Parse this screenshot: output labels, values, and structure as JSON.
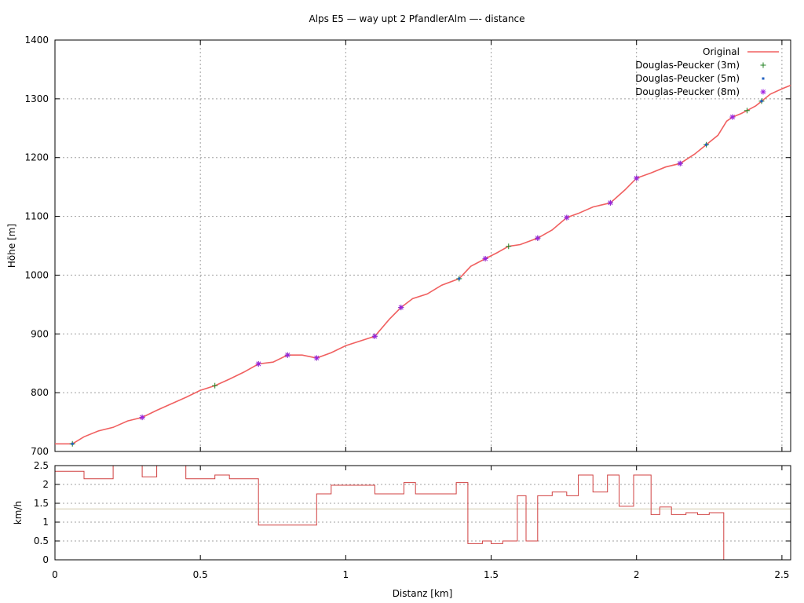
{
  "title": "Alps E5 — way upt 2 PfandlerAlm —- distance",
  "colors": {
    "original": "#f06060",
    "dp3": "#208020",
    "dp5": "#2060c0",
    "dp8": "#a020e0",
    "speed": "#d04040",
    "avg": "#d8d0b8",
    "grid": "#a0a0a0"
  },
  "chart_data": [
    {
      "type": "line",
      "ylabel": "Höhe [m]",
      "xlim": [
        0,
        2.53
      ],
      "ylim": [
        700,
        1400
      ],
      "grid": true,
      "legend_position": "top-right",
      "xticks": [
        "0",
        "0.5",
        "1",
        "1.5",
        "2",
        "2.5"
      ],
      "yticks": [
        "700",
        "800",
        "900",
        "1000",
        "1100",
        "1200",
        "1300",
        "1400"
      ],
      "series": [
        {
          "name": "Original",
          "style": "line",
          "x": [
            0,
            0.06,
            0.1,
            0.15,
            0.2,
            0.25,
            0.3,
            0.35,
            0.4,
            0.45,
            0.5,
            0.55,
            0.6,
            0.65,
            0.7,
            0.75,
            0.8,
            0.85,
            0.9,
            0.95,
            1.0,
            1.05,
            1.1,
            1.15,
            1.19,
            1.23,
            1.28,
            1.33,
            1.39,
            1.43,
            1.48,
            1.52,
            1.56,
            1.6,
            1.66,
            1.71,
            1.76,
            1.8,
            1.85,
            1.91,
            1.96,
            2.0,
            2.05,
            2.1,
            2.15,
            2.2,
            2.24,
            2.28,
            2.31,
            2.33,
            2.36,
            2.38,
            2.41,
            2.43,
            2.46,
            2.5,
            2.53
          ],
          "y": [
            713,
            713,
            725,
            735,
            741,
            752,
            758,
            770,
            781,
            792,
            804,
            812,
            823,
            835,
            849,
            852,
            864,
            864,
            859,
            868,
            880,
            888,
            896,
            925,
            945,
            960,
            968,
            983,
            994,
            1015,
            1028,
            1038,
            1049,
            1052,
            1063,
            1077,
            1098,
            1105,
            1116,
            1123,
            1145,
            1165,
            1174,
            1184,
            1190,
            1206,
            1222,
            1238,
            1262,
            1269,
            1275,
            1280,
            1288,
            1296,
            1308,
            1317,
            1323
          ]
        },
        {
          "name": "Douglas-Peucker (3m)",
          "style": "plus",
          "x": [
            0.06,
            0.3,
            0.55,
            0.7,
            0.8,
            0.9,
            1.1,
            1.19,
            1.39,
            1.48,
            1.56,
            1.66,
            1.76,
            1.91,
            2.0,
            2.15,
            2.24,
            2.33,
            2.38,
            2.43
          ],
          "y": [
            713,
            758,
            812,
            849,
            864,
            859,
            896,
            945,
            994,
            1028,
            1049,
            1063,
            1098,
            1123,
            1165,
            1190,
            1222,
            1269,
            1280,
            1296
          ]
        },
        {
          "name": "Douglas-Peucker (5m)",
          "style": "square",
          "x": [
            0.06,
            0.3,
            0.7,
            0.8,
            0.9,
            1.1,
            1.19,
            1.39,
            1.48,
            1.66,
            1.76,
            1.91,
            2.0,
            2.15,
            2.24,
            2.33,
            2.43
          ],
          "y": [
            713,
            758,
            849,
            864,
            859,
            896,
            945,
            994,
            1028,
            1063,
            1098,
            1123,
            1165,
            1190,
            1222,
            1269,
            1296
          ]
        },
        {
          "name": "Douglas-Peucker (8m)",
          "style": "star",
          "x": [
            0.3,
            0.7,
            0.8,
            0.9,
            1.1,
            1.19,
            1.48,
            1.66,
            1.76,
            1.91,
            2.0,
            2.15,
            2.33
          ],
          "y": [
            758,
            849,
            864,
            859,
            896,
            945,
            1028,
            1063,
            1098,
            1123,
            1165,
            1190,
            1269
          ]
        }
      ]
    },
    {
      "type": "line",
      "xlabel": "Distanz [km]",
      "ylabel": "km/h",
      "xlim": [
        0,
        2.53
      ],
      "ylim": [
        0,
        2.5
      ],
      "grid": true,
      "xticks": [
        "0",
        "0.5",
        "1",
        "1.5",
        "2",
        "2.5"
      ],
      "yticks": [
        "0",
        "0.5",
        "1",
        "1.5",
        "2",
        "2.5"
      ],
      "average_speed": 1.35,
      "speed_steps": {
        "x": [
          0,
          0.1,
          0.2,
          0.3,
          0.35,
          0.45,
          0.55,
          0.6,
          0.7,
          0.9,
          0.95,
          1.1,
          1.15,
          1.2,
          1.24,
          1.38,
          1.42,
          1.47,
          1.5,
          1.54,
          1.59,
          1.62,
          1.66,
          1.71,
          1.76,
          1.8,
          1.85,
          1.9,
          1.94,
          1.99,
          2.05,
          2.08,
          2.12,
          2.17,
          2.21,
          2.25,
          2.3,
          2.33,
          2.38
        ],
        "y": [
          2.35,
          2.15,
          2.5,
          2.2,
          2.5,
          2.15,
          2.25,
          2.15,
          0.92,
          1.75,
          1.98,
          1.75,
          1.75,
          2.05,
          1.75,
          2.05,
          0.43,
          0.5,
          0.43,
          0.5,
          1.7,
          0.5,
          1.7,
          1.8,
          1.7,
          2.25,
          1.8,
          2.25,
          1.42,
          2.25,
          1.2,
          1.4,
          1.2,
          1.25,
          1.2,
          1.25,
          0
        ],
        "end_x": 2.38
      }
    }
  ]
}
